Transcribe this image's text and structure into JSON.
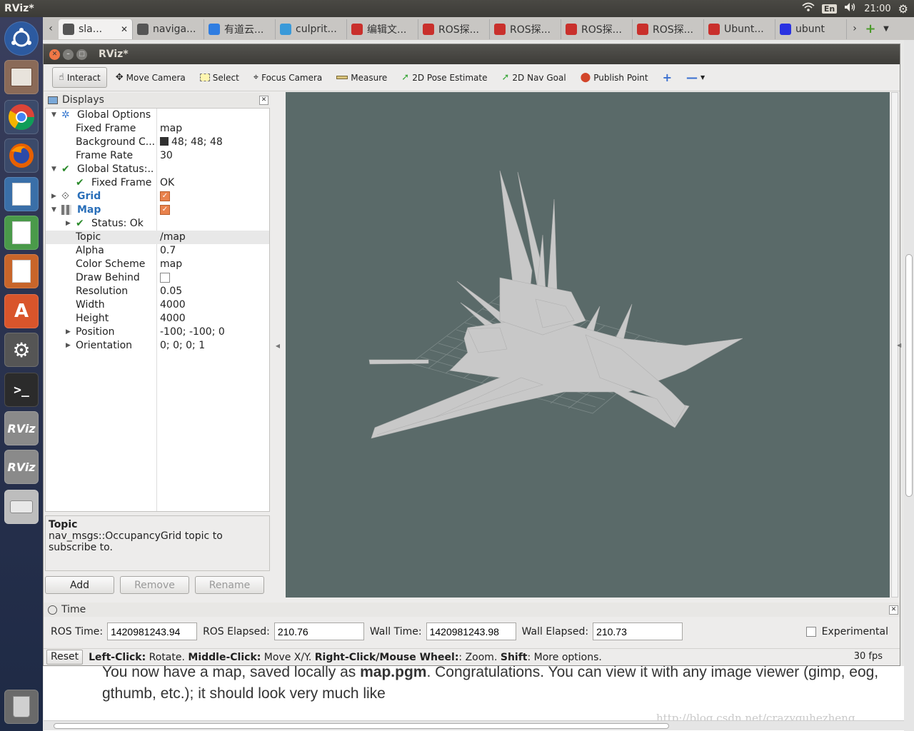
{
  "topbar": {
    "app_title": "RViz*",
    "lang": "En",
    "clock": "21:00"
  },
  "browser_tabs": [
    {
      "label": "sla...",
      "icon": "grid-icon",
      "color": "#555555",
      "active": true
    },
    {
      "label": "naviga...",
      "icon": "grid-icon",
      "color": "#555555"
    },
    {
      "label": "有道云...",
      "icon": "youdao-icon",
      "color": "#2f7de1"
    },
    {
      "label": "culprit...",
      "icon": "d-icon",
      "color": "#3a9ad9"
    },
    {
      "label": "编辑文...",
      "icon": "csdn-icon",
      "color": "#c9302c"
    },
    {
      "label": "ROS探...",
      "icon": "csdn-icon",
      "color": "#c9302c"
    },
    {
      "label": "ROS探...",
      "icon": "csdn-icon",
      "color": "#c9302c"
    },
    {
      "label": "ROS探...",
      "icon": "csdn-icon",
      "color": "#c9302c"
    },
    {
      "label": "ROS探...",
      "icon": "csdn-icon",
      "color": "#c9302c"
    },
    {
      "label": "Ubunt...",
      "icon": "csdn-icon",
      "color": "#c9302c"
    },
    {
      "label": "ubunt",
      "icon": "baidu-icon",
      "color": "#2932e1"
    }
  ],
  "window": {
    "title": "RViz*"
  },
  "toolbar": {
    "interact": "Interact",
    "move_camera": "Move Camera",
    "select": "Select",
    "focus_camera": "Focus Camera",
    "measure": "Measure",
    "pose_estimate": "2D Pose Estimate",
    "nav_goal": "2D Nav Goal",
    "publish_point": "Publish Point"
  },
  "displays": {
    "title": "Displays",
    "rows": {
      "global_options": "Global Options",
      "fixed_frame_k": "Fixed Frame",
      "fixed_frame_v": "map",
      "background_k": "Background C...",
      "background_v": "48; 48; 48",
      "frame_rate_k": "Frame Rate",
      "frame_rate_v": "30",
      "global_status": "Global Status:...",
      "gs_fixed_frame_k": "Fixed Frame",
      "gs_fixed_frame_v": "OK",
      "grid": "Grid",
      "map": "Map",
      "status_ok": "Status: Ok",
      "topic_k": "Topic",
      "topic_v": "/map",
      "alpha_k": "Alpha",
      "alpha_v": "0.7",
      "color_scheme_k": "Color Scheme",
      "color_scheme_v": "map",
      "draw_behind_k": "Draw Behind",
      "resolution_k": "Resolution",
      "resolution_v": "0.05",
      "width_k": "Width",
      "width_v": "4000",
      "height_k": "Height",
      "height_v": "4000",
      "position_k": "Position",
      "position_v": "-100; -100; 0",
      "orientation_k": "Orientation",
      "orientation_v": "0; 0; 0; 1"
    },
    "desc_title": "Topic",
    "desc_text": "nav_msgs::OccupancyGrid topic to subscribe to.",
    "add": "Add",
    "remove": "Remove",
    "rename": "Rename"
  },
  "time": {
    "title": "Time",
    "ros_time_label": "ROS Time:",
    "ros_time": "1420981243.94",
    "ros_elapsed_label": "ROS Elapsed:",
    "ros_elapsed": "210.76",
    "wall_time_label": "Wall Time:",
    "wall_time": "1420981243.98",
    "wall_elapsed_label": "Wall Elapsed:",
    "wall_elapsed": "210.73",
    "experimental": "Experimental"
  },
  "status": {
    "reset": "Reset",
    "lc": "Left-Click:",
    "lc_t": " Rotate. ",
    "mc": "Middle-Click:",
    "mc_t": " Move X/Y. ",
    "rc": "Right-Click/Mouse Wheel:",
    "rc_t": ": Zoom. ",
    "sh": "Shift",
    "sh_t": ": More options.",
    "fps": "30 fps"
  },
  "webpage": {
    "t1": "You now have a map, saved locally as ",
    "t2": "map.pgm",
    "t3": ". Congratulations. You can view it with any image viewer (gimp, eog, gthumb, etc.); it should look very much like",
    "watermark": "http://blog.csdn.net/crazyquhezheng"
  },
  "colors": {
    "viewport_bg": "#5a6a69",
    "map_free": "#c8c8c8",
    "grid_line": "#8a9695"
  }
}
